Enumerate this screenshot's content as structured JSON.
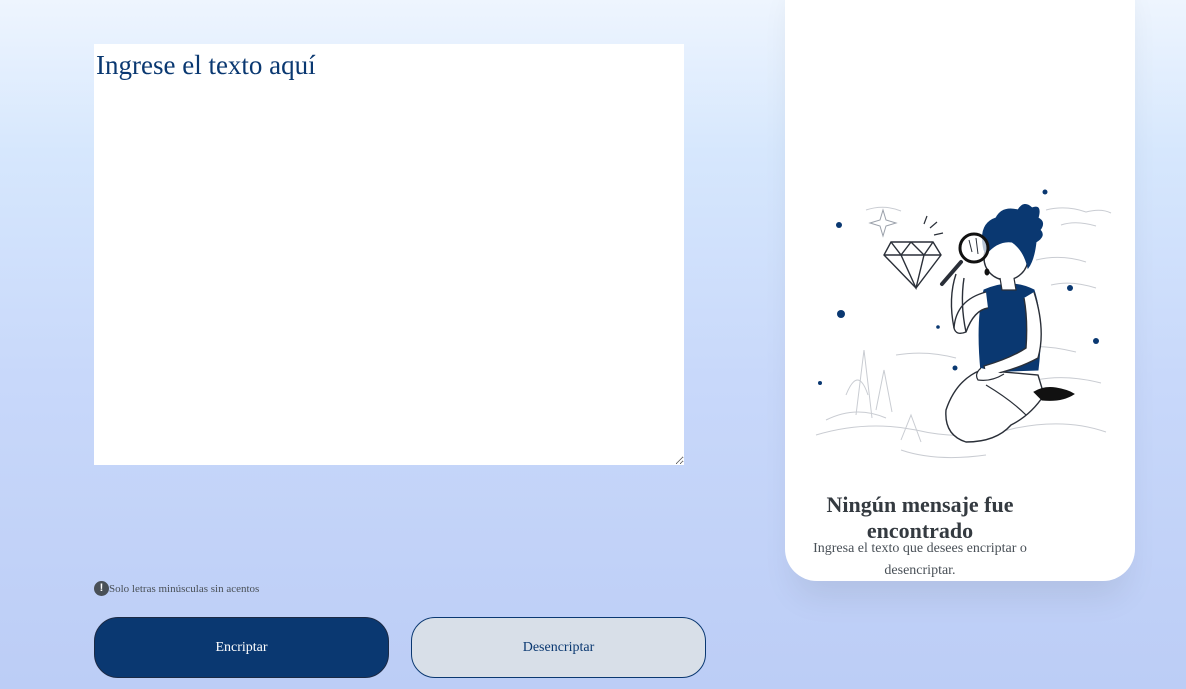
{
  "editor": {
    "placeholder": "Ingrese el texto aquí"
  },
  "hint": {
    "icon": "exclamation-circle-icon",
    "text": "Solo letras minúsculas sin acentos"
  },
  "buttons": {
    "encrypt_label": "Encriptar",
    "decrypt_label": "Desencriptar"
  },
  "output_panel": {
    "illustration": "person-with-magnifying-glass-and-diamond",
    "title": "Ningún mensaje fue encontrado",
    "message": "Ingresa el texto que desees encriptar o desencriptar."
  },
  "colors": {
    "primary": "#0a3871",
    "secondary_bg": "#d8dfe8",
    "panel_bg": "#ffffff",
    "text_dark": "#343a40",
    "text_muted": "#495057"
  }
}
